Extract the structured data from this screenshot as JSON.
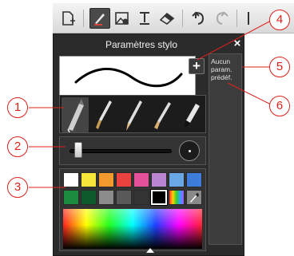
{
  "panel": {
    "title": "Paramètres stylo",
    "close_label": "×",
    "add_preset_label": "+",
    "no_presets_text": "Aucun param. prédéf."
  },
  "toolbar": {
    "icons": [
      "add-page-icon",
      "pen-icon",
      "image-icon",
      "text-icon",
      "eraser-icon",
      "undo-icon",
      "redo-icon"
    ],
    "selected": "pen-icon"
  },
  "brushes": [
    "fountain-pen",
    "brush",
    "pencil",
    "chisel-brush",
    "marker"
  ],
  "selected_brush": "fountain-pen",
  "size_slider_value": 0.05,
  "palette": {
    "row1": [
      "#ffffff",
      "#f7e53a",
      "#f39a2e",
      "#e9423f",
      "#e4509a",
      "#b985d3",
      "#6aa7e6",
      "#3d7cd8"
    ],
    "row2": [
      "#1a8a3c",
      "#0f5a2c",
      "#8c8c8c",
      "#595959",
      "#333333",
      "#000000",
      "rainbow",
      "eyedropper"
    ],
    "selected_color": "#000000"
  },
  "callouts": [
    "1",
    "2",
    "3",
    "4",
    "5",
    "6"
  ],
  "colors": {
    "callout": "#e0201a",
    "panel_bg": "#2b2b2b"
  }
}
